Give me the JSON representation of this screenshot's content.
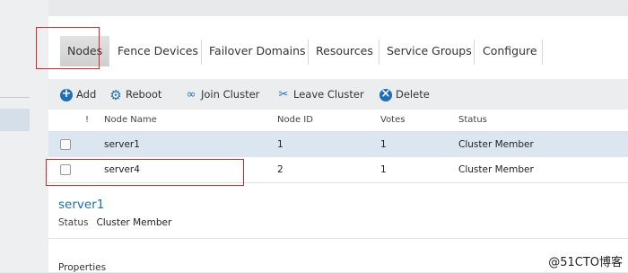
{
  "tabs": [
    {
      "label": "Nodes",
      "active": true
    },
    {
      "label": "Fence Devices"
    },
    {
      "label": "Failover Domains"
    },
    {
      "label": "Resources"
    },
    {
      "label": "Service Groups"
    },
    {
      "label": "Configure"
    }
  ],
  "toolbar": {
    "add": "Add",
    "reboot": "Reboot",
    "join": "Join Cluster",
    "leave": "Leave Cluster",
    "delete": "Delete"
  },
  "table": {
    "headers": {
      "flag": "!",
      "name": "Node Name",
      "id": "Node ID",
      "votes": "Votes",
      "status": "Status"
    },
    "rows": [
      {
        "name": "server1",
        "id": "1",
        "votes": "1",
        "status": "Cluster Member",
        "selected": true
      },
      {
        "name": "server4",
        "id": "2",
        "votes": "1",
        "status": "Cluster Member",
        "selected": false
      }
    ]
  },
  "detail": {
    "title": "server1",
    "status_label": "Status",
    "status_value": "Cluster Member"
  },
  "properties_label": "Properties",
  "watermark": "@51CTO博客",
  "colors": {
    "accent": "#1d6fb8",
    "highlight": "#d9262c",
    "selected_row": "#dbe6f1"
  }
}
